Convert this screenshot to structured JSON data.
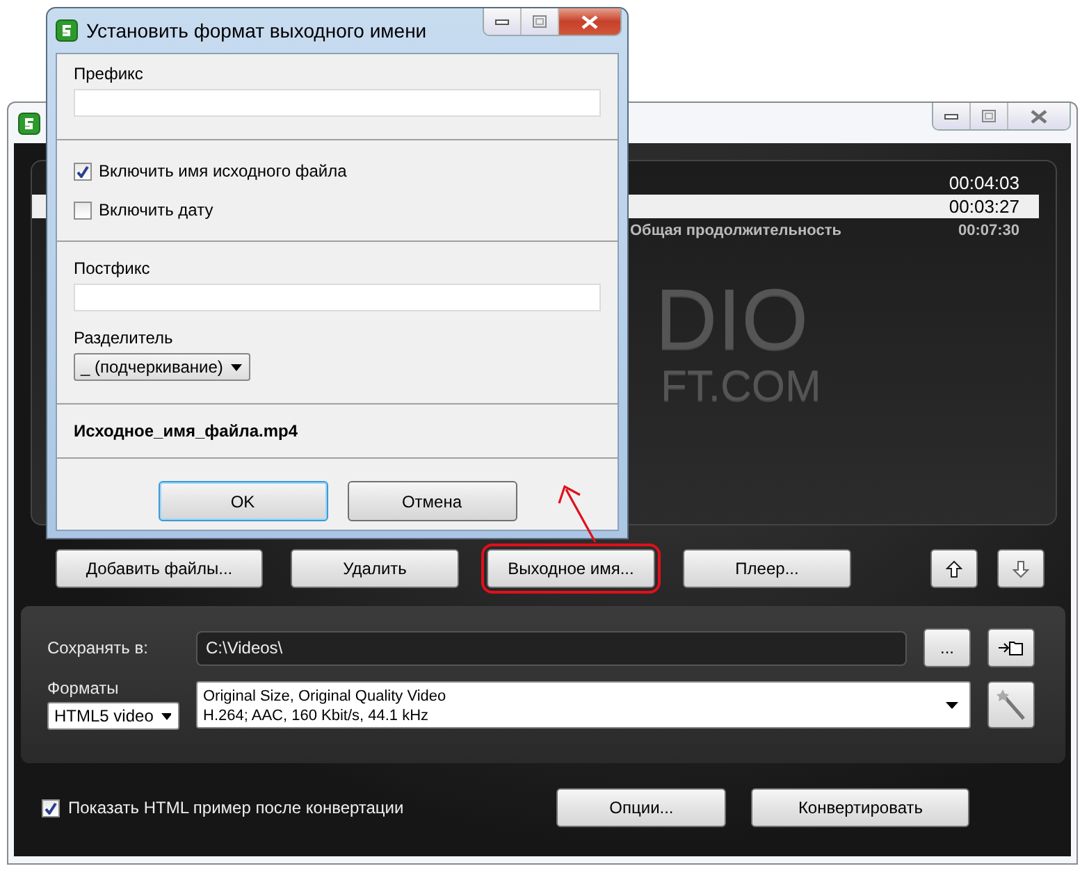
{
  "main_window": {
    "files": [
      {
        "duration": "00:04:03",
        "selected": false
      },
      {
        "duration": "00:03:27",
        "selected": true
      }
    ],
    "total": {
      "label": "Общая продолжительность",
      "duration": "00:07:30"
    },
    "logo": [
      "DIO",
      "FT.COM"
    ],
    "buttons": [
      {
        "label": "Добавить файлы...",
        "highlighted": false
      },
      {
        "label": "Удалить",
        "highlighted": false
      },
      {
        "label": "Выходное имя...",
        "highlighted": true
      },
      {
        "label": "Плеер...",
        "highlighted": false
      }
    ],
    "save_to": {
      "label": "Сохранять в:",
      "value": "C:\\Videos\\",
      "browse": "..."
    },
    "formats": {
      "label": "Форматы",
      "value": "HTML5 video",
      "preset": [
        "Original Size, Original Quality Video",
        "H.264; AAC, 160 Kbit/s, 44.1 kHz"
      ]
    },
    "show_html": {
      "label": "Показать HTML пример после конвертации",
      "checked": true
    },
    "bottom_buttons": [
      "Опции...",
      "Конвертировать"
    ]
  },
  "dialog": {
    "title": "Установить формат выходного имени",
    "prefix": {
      "label": "Префикс"
    },
    "options": [
      {
        "label": "Включить имя исходного файла",
        "checked": true
      },
      {
        "label": "Включить дату",
        "checked": false
      }
    ],
    "postfix": {
      "label": "Постфикс"
    },
    "separator": {
      "label": "Разделитель",
      "value": "_ (подчеркивание)"
    },
    "preview": "Исходное_имя_файла.mp4",
    "buttons": [
      {
        "label": "OK",
        "default": true
      },
      {
        "label": "Отмена",
        "default": false
      }
    ]
  }
}
